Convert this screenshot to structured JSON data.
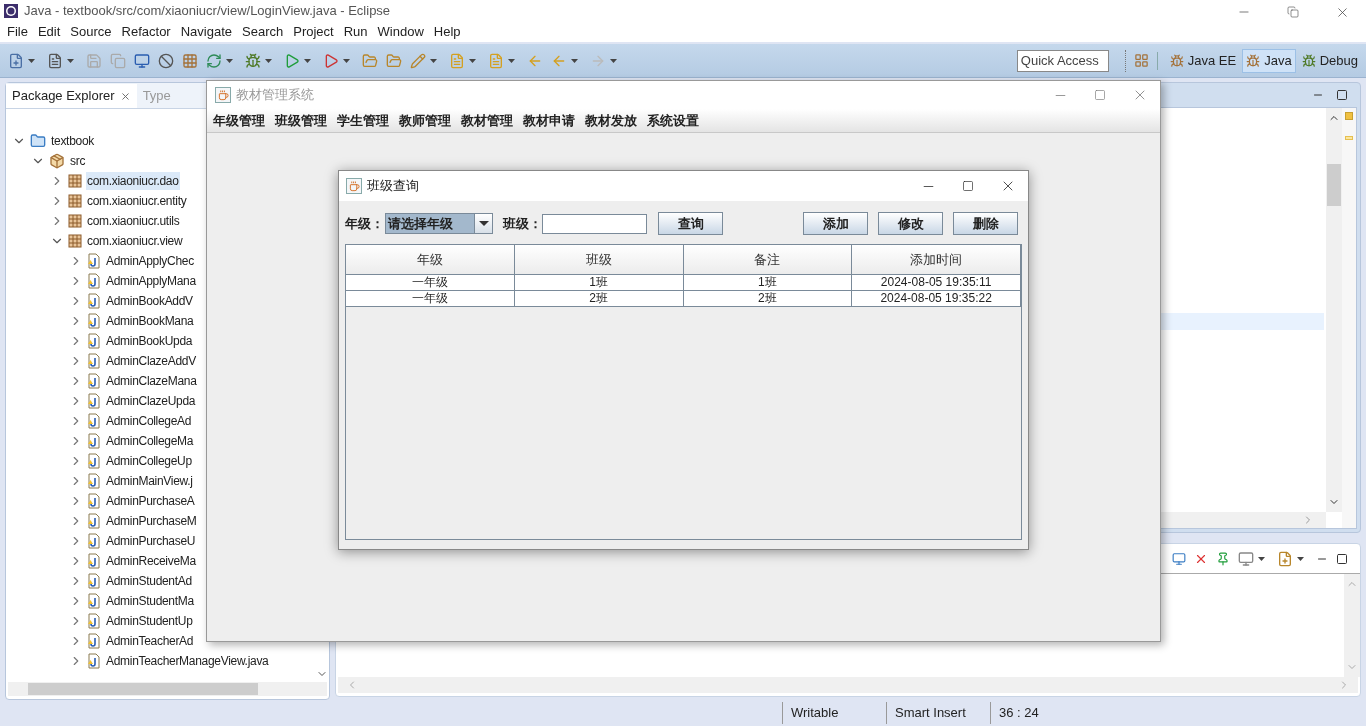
{
  "window": {
    "title": "Java - textbook/src/com/xiaoniucr/view/LoginView.java - Eclipse"
  },
  "menu": [
    "File",
    "Edit",
    "Source",
    "Refactor",
    "Navigate",
    "Search",
    "Project",
    "Run",
    "Window",
    "Help"
  ],
  "toolbar": {
    "quick_access": {
      "placeholder": "Quick Access"
    },
    "perspectives": [
      {
        "label": "Java EE",
        "selected": false
      },
      {
        "label": "Java",
        "selected": true
      },
      {
        "label": "Debug",
        "selected": false
      }
    ]
  },
  "package_explorer": {
    "tabs": [
      {
        "label": "Package Explorer",
        "selected": true
      },
      {
        "label": "Type",
        "selected": false
      }
    ],
    "tree": [
      {
        "label": "textbook",
        "kind": "project",
        "expanded": true,
        "selected": false,
        "children": [
          {
            "label": "src",
            "kind": "source_folder",
            "expanded": true,
            "selected": false,
            "children": [
              {
                "label": "com.xiaoniucr.dao",
                "kind": "package",
                "expanded": false,
                "selected": true
              },
              {
                "label": "com.xiaoniucr.entity",
                "kind": "package",
                "expanded": false,
                "selected": false
              },
              {
                "label": "com.xiaoniucr.utils",
                "kind": "package",
                "expanded": false,
                "selected": false
              },
              {
                "label": "com.xiaoniucr.view",
                "kind": "package",
                "expanded": true,
                "selected": false,
                "children": [
                  {
                    "label": "AdminApplyChec",
                    "kind": "java_file",
                    "expanded": false,
                    "selected": false
                  },
                  {
                    "label": "AdminApplyMana",
                    "kind": "java_file",
                    "expanded": false,
                    "selected": false
                  },
                  {
                    "label": "AdminBookAddV",
                    "kind": "java_file",
                    "expanded": false,
                    "selected": false
                  },
                  {
                    "label": "AdminBookMana",
                    "kind": "java_file",
                    "expanded": false,
                    "selected": false
                  },
                  {
                    "label": "AdminBookUpda",
                    "kind": "java_file",
                    "expanded": false,
                    "selected": false
                  },
                  {
                    "label": "AdminClazeAddV",
                    "kind": "java_file",
                    "expanded": false,
                    "selected": false
                  },
                  {
                    "label": "AdminClazeMana",
                    "kind": "java_file",
                    "expanded": false,
                    "selected": false
                  },
                  {
                    "label": "AdminClazeUpda",
                    "kind": "java_file",
                    "expanded": false,
                    "selected": false
                  },
                  {
                    "label": "AdminCollegeAd",
                    "kind": "java_file",
                    "expanded": false,
                    "selected": false
                  },
                  {
                    "label": "AdminCollegeMa",
                    "kind": "java_file",
                    "expanded": false,
                    "selected": false
                  },
                  {
                    "label": "AdminCollegeUp",
                    "kind": "java_file",
                    "expanded": false,
                    "selected": false
                  },
                  {
                    "label": "AdminMainView.j",
                    "kind": "java_file",
                    "expanded": false,
                    "selected": false
                  },
                  {
                    "label": "AdminPurchaseA",
                    "kind": "java_file",
                    "expanded": false,
                    "selected": false
                  },
                  {
                    "label": "AdminPurchaseM",
                    "kind": "java_file",
                    "expanded": false,
                    "selected": false
                  },
                  {
                    "label": "AdminPurchaseU",
                    "kind": "java_file",
                    "expanded": false,
                    "selected": false
                  },
                  {
                    "label": "AdminReceiveMa",
                    "kind": "java_file",
                    "expanded": false,
                    "selected": false
                  },
                  {
                    "label": "AdminStudentAd",
                    "kind": "java_file",
                    "expanded": false,
                    "selected": false
                  },
                  {
                    "label": "AdminStudentMa",
                    "kind": "java_file",
                    "expanded": false,
                    "selected": false
                  },
                  {
                    "label": "AdminStudentUp",
                    "kind": "java_file",
                    "expanded": false,
                    "selected": false
                  },
                  {
                    "label": "AdminTeacherAd",
                    "kind": "java_file",
                    "expanded": false,
                    "selected": false
                  },
                  {
                    "label": "AdminTeacherManageView.java",
                    "kind": "java_file",
                    "expanded": false,
                    "selected": false
                  }
                ]
              }
            ]
          }
        ]
      }
    ]
  },
  "status_bar": [
    "Writable",
    "Smart Insert",
    "36 : 24"
  ],
  "app_window": {
    "title": "教材管理系统",
    "active": false,
    "menu": [
      "年级管理",
      "班级管理",
      "学生管理",
      "教师管理",
      "教材管理",
      "教材申请",
      "教材发放",
      "系统设置"
    ]
  },
  "dialog": {
    "title": "班级查询",
    "active": true,
    "grade_label": "年级：",
    "grade_select": {
      "value": "请选择年级",
      "selected": true
    },
    "class_label": "班级：",
    "search_button": "查询",
    "actions": [
      "添加",
      "修改",
      "删除"
    ],
    "table": {
      "columns": [
        "年级",
        "班级",
        "备注",
        "添加时间"
      ],
      "rows": [
        [
          "一年级",
          "1班",
          "1班",
          "2024-08-05 19:35:11"
        ],
        [
          "一年级",
          "2班",
          "2班",
          "2024-08-05 19:35:22"
        ]
      ]
    }
  }
}
